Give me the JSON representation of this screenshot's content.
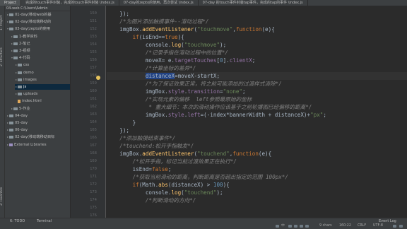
{
  "tabs": [
    "Project",
    "完成的touch事件封装，完成的touch事件封装 \\index.js",
    "07-day的zepto的使用，再次尝试 \\index.js",
    "07-day 的touch事件封装tap事件，完成的tap的事件 \\index.js"
  ],
  "sidebar": {
    "header": "04-web  C:\\Users\\Admin",
    "items": [
      {
        "label": "01-day(移动web的基",
        "indent": 0,
        "kind": "folder"
      },
      {
        "label": "02-day(移动端移动的",
        "indent": 0,
        "kind": "folder"
      },
      {
        "label": "03-day(zepto的使用",
        "indent": 0,
        "kind": "folder",
        "open": true
      },
      {
        "label": "1-教学资料",
        "indent": 1,
        "kind": "folder"
      },
      {
        "label": "2-笔记",
        "indent": 1,
        "kind": "folder"
      },
      {
        "label": "3-视频",
        "indent": 1,
        "kind": "folder"
      },
      {
        "label": "4-代码",
        "indent": 1,
        "kind": "folder",
        "open": true
      },
      {
        "label": "css",
        "indent": 2,
        "kind": "folder"
      },
      {
        "label": "demo",
        "indent": 2,
        "kind": "folder"
      },
      {
        "label": "images",
        "indent": 2,
        "kind": "folder"
      },
      {
        "label": "js",
        "indent": 2,
        "kind": "folder",
        "selected": true
      },
      {
        "label": "uploads",
        "indent": 2,
        "kind": "folder"
      },
      {
        "label": "index.html",
        "indent": 2,
        "kind": "file"
      },
      {
        "label": "5-作业",
        "indent": 1,
        "kind": "folder"
      },
      {
        "label": "04-day",
        "indent": 0,
        "kind": "folder"
      },
      {
        "label": "05-day",
        "indent": 0,
        "kind": "folder"
      },
      {
        "label": "06-day",
        "indent": 0,
        "kind": "folder"
      },
      {
        "label": "02-day(移动端移动目标",
        "indent": 0,
        "kind": "folder"
      },
      {
        "label": "External Libraries",
        "indent": 0,
        "kind": "lib"
      }
    ]
  },
  "left_tabs": [
    "1: Project",
    "2: Structure",
    "2: Favorites"
  ],
  "gutter_lines": [
    "150",
    "151",
    "152",
    "153",
    "154",
    "155",
    "156",
    "157",
    "158",
    "159",
    "160",
    "161",
    "162",
    "163",
    "164",
    "165",
    "166",
    "167",
    "168",
    "169",
    "170",
    "171",
    "172",
    "173",
    "174",
    "175",
    "176"
  ],
  "code": [
    "    });",
    "    /*为图片添加触摸事件--滑动过程*/",
    "    imgBox.addEventListener(\"touchmove\",function(e){",
    "        if(isEnd==true){",
    "            console.log(\"touchmove\");",
    "            /*记录手指在滑动过程中的位置*/",
    "            moveX= e.targetTouches[0].clientX;",
    "            /*计算坐标的差异*/",
    "            distanceX=moveX-startX;",
    "            /*为了保证效果正常，将之前可能添加的过渡样式清除*/",
    "            imgBox.style.transition=\"none\";",
    "            /*实现元素的偏移  left参照最原始的坐标",
    "             * 重大细节：本次的滑动操作应该基于之前轮播图已经偏移的距离*/",
    "            imgBox.style.left=(-index*bannerWidth + distanceX)+\"px\";",
    "        }",
    "    });",
    "    /*添加触摸结束事件*/",
    "    /*touchend:松开手指触发*/",
    "    imgBox.addEventListener(\"touchend\",function(e){",
    "        /*松开手指，标记当前过渡效果正在执行*/",
    "        isEnd=false;",
    "        /*获取当前滑动的距离，判断距离是否超出指定的范围 100px*/",
    "        if(Math.abs(distanceX) > 100){",
    "            console.log(\"touchend\");",
    "            /*判断滑动的方向*/"
  ],
  "bottom_tools": [
    "6: TODO",
    "Terminal",
    "Event Log"
  ],
  "status": {
    "chars": "9 chars",
    "position": "160:22",
    "line_sep": "CRLF",
    "encoding": "UTF-8",
    "ime": "中"
  },
  "colors": {
    "background": "#2b2b2b",
    "keyword": "#cc7832",
    "string": "#6a8759",
    "comment": "#808080",
    "selection": "#214283"
  }
}
